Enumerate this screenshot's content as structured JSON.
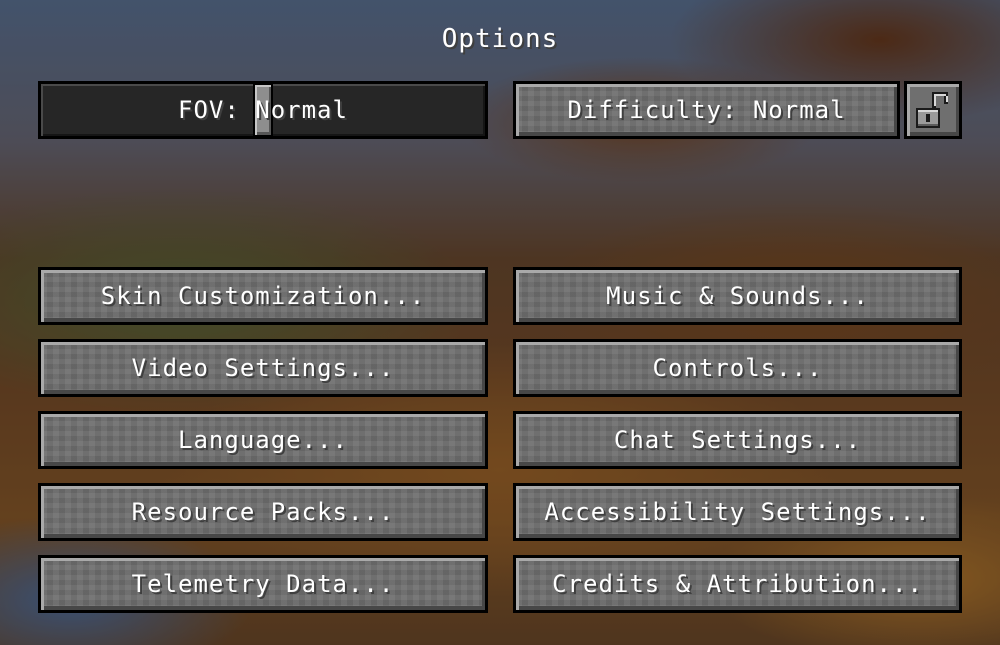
{
  "screen": {
    "title": "Options"
  },
  "fov": {
    "label": "FOV: Normal",
    "value": 70,
    "min": 30,
    "max": 110
  },
  "difficulty": {
    "label": "Difficulty: Normal",
    "lock_icon": "unlocked-padlock-icon"
  },
  "buttons": {
    "skin": "Skin Customization...",
    "music": "Music & Sounds...",
    "video": "Video Settings...",
    "controls": "Controls...",
    "language": "Language...",
    "chat": "Chat Settings...",
    "resource": "Resource Packs...",
    "accessibility": "Accessibility Settings...",
    "telemetry": "Telemetry Data...",
    "credits": "Credits & Attribution..."
  },
  "colors": {
    "button_face": "#6f6f6f",
    "slider_track": "#262626",
    "text": "#ffffff"
  }
}
